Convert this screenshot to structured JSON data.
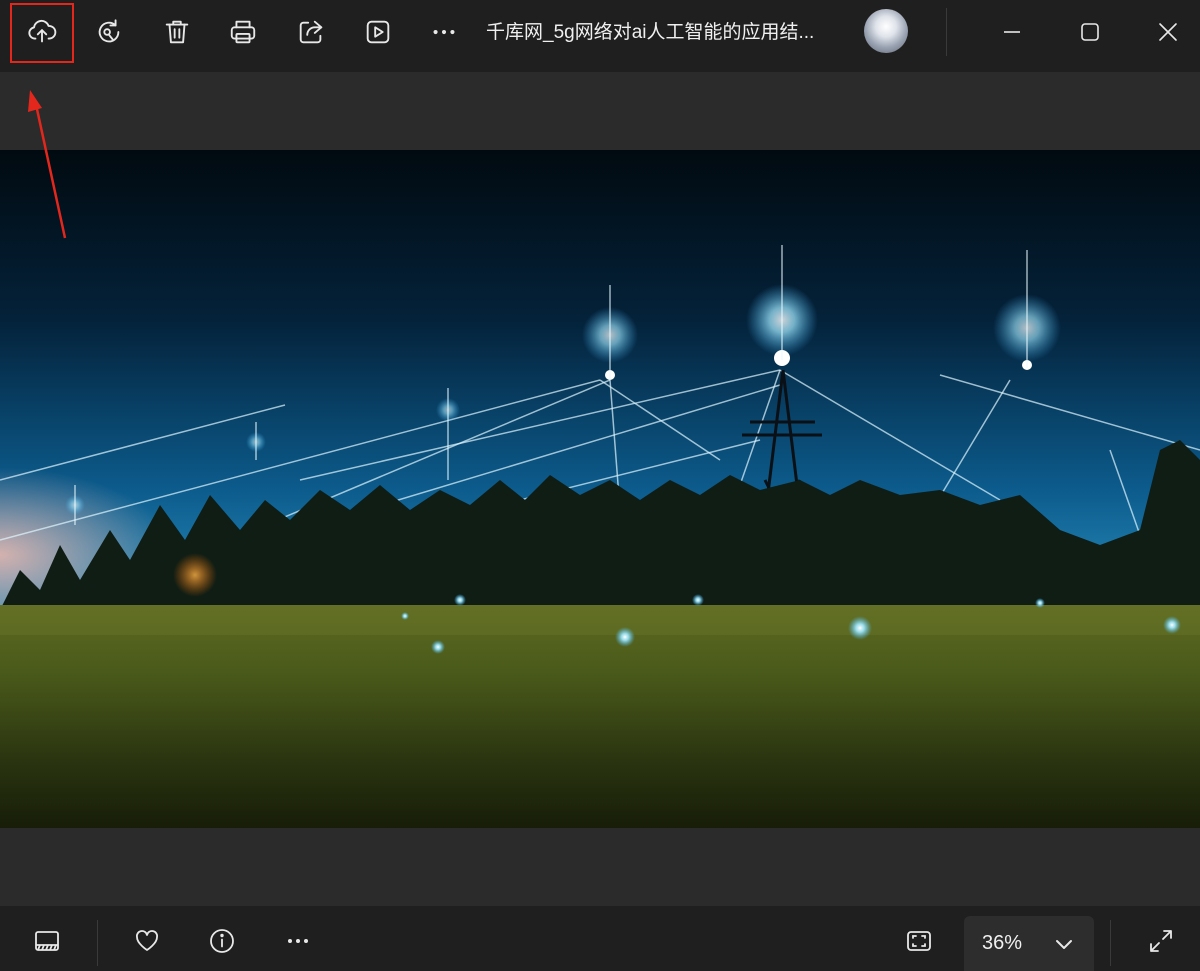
{
  "toolbar": {
    "title": "千库网_5g网络对ai人工智能的应用结...",
    "buttons": [
      {
        "name": "upload-icon"
      },
      {
        "name": "rotate-icon"
      },
      {
        "name": "trash-icon"
      },
      {
        "name": "print-icon"
      },
      {
        "name": "share-icon"
      },
      {
        "name": "slideshow-icon"
      },
      {
        "name": "more-icon"
      }
    ],
    "window_controls": [
      "minimize-icon",
      "maximize-icon",
      "close-icon"
    ]
  },
  "bottombar": {
    "zoom_level": "36%",
    "buttons": [
      "filmstrip-icon",
      "heart-icon",
      "info-icon",
      "more-icon",
      "fit-screen-icon",
      "fullscreen-icon"
    ]
  },
  "annotation": {
    "color": "#e3271d"
  },
  "colors": {
    "toolbar_bg": "#1f1f1f",
    "band_bg": "#2b2b2b",
    "icon": "#e8e8e8"
  }
}
